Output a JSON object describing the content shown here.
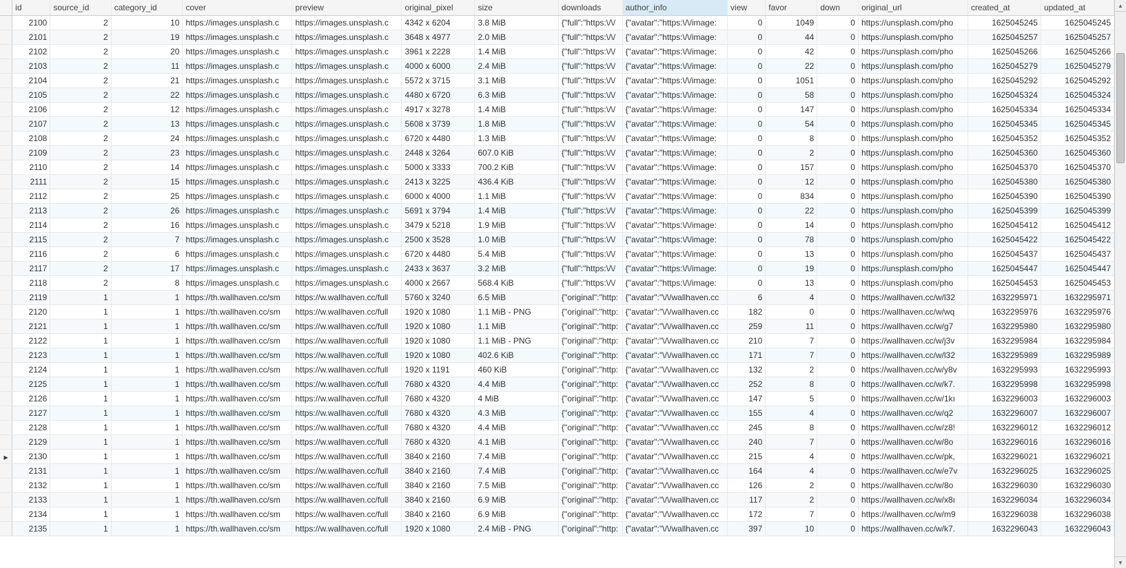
{
  "columns": [
    "id",
    "source_id",
    "category_id",
    "cover",
    "preview",
    "original_pixel",
    "size",
    "downloads",
    "author_info",
    "view",
    "favor",
    "down",
    "original_url",
    "created_at",
    "updated_at"
  ],
  "selected_column_index": 8,
  "current_row_id": 2130,
  "rows": [
    {
      "id": 2100,
      "source_id": 2,
      "category_id": 10,
      "cover": "https://images.unsplash.c",
      "preview": "https://images.unsplash.c",
      "original_pixel": "4342 x 6204",
      "size": "3.8 MiB",
      "downloads": "{\"full\":\"https:\\/\\/",
      "author_info": "{\"avatar\":\"https:\\/\\/image:",
      "view": 0,
      "favor": 1049,
      "down": 0,
      "original_url": "https://unsplash.com/pho",
      "created_at": 1625045245,
      "updated_at": 1625045245
    },
    {
      "id": 2101,
      "source_id": 2,
      "category_id": 19,
      "cover": "https://images.unsplash.c",
      "preview": "https://images.unsplash.c",
      "original_pixel": "3648 x 4977",
      "size": "2.0 MiB",
      "downloads": "{\"full\":\"https:\\/\\/",
      "author_info": "{\"avatar\":\"https:\\/\\/image:",
      "view": 0,
      "favor": 44,
      "down": 0,
      "original_url": "https://unsplash.com/pho",
      "created_at": 1625045257,
      "updated_at": 1625045257
    },
    {
      "id": 2102,
      "source_id": 2,
      "category_id": 20,
      "cover": "https://images.unsplash.c",
      "preview": "https://images.unsplash.c",
      "original_pixel": "3961 x 2228",
      "size": "1.4 MiB",
      "downloads": "{\"full\":\"https:\\/\\/",
      "author_info": "{\"avatar\":\"https:\\/\\/image:",
      "view": 0,
      "favor": 42,
      "down": 0,
      "original_url": "https://unsplash.com/pho",
      "created_at": 1625045266,
      "updated_at": 1625045266
    },
    {
      "id": 2103,
      "source_id": 2,
      "category_id": 11,
      "cover": "https://images.unsplash.c",
      "preview": "https://images.unsplash.c",
      "original_pixel": "4000 x 6000",
      "size": "2.4 MiB",
      "downloads": "{\"full\":\"https:\\/\\/",
      "author_info": "{\"avatar\":\"https:\\/\\/image:",
      "view": 0,
      "favor": 22,
      "down": 0,
      "original_url": "https://unsplash.com/pho",
      "created_at": 1625045279,
      "updated_at": 1625045279
    },
    {
      "id": 2104,
      "source_id": 2,
      "category_id": 21,
      "cover": "https://images.unsplash.c",
      "preview": "https://images.unsplash.c",
      "original_pixel": "5572 x 3715",
      "size": "3.1 MiB",
      "downloads": "{\"full\":\"https:\\/\\/",
      "author_info": "{\"avatar\":\"https:\\/\\/image:",
      "view": 0,
      "favor": 1051,
      "down": 0,
      "original_url": "https://unsplash.com/pho",
      "created_at": 1625045292,
      "updated_at": 1625045292
    },
    {
      "id": 2105,
      "source_id": 2,
      "category_id": 22,
      "cover": "https://images.unsplash.c",
      "preview": "https://images.unsplash.c",
      "original_pixel": "4480 x 6720",
      "size": "6.3 MiB",
      "downloads": "{\"full\":\"https:\\/\\/",
      "author_info": "{\"avatar\":\"https:\\/\\/image:",
      "view": 0,
      "favor": 58,
      "down": 0,
      "original_url": "https://unsplash.com/pho",
      "created_at": 1625045324,
      "updated_at": 1625045324
    },
    {
      "id": 2106,
      "source_id": 2,
      "category_id": 12,
      "cover": "https://images.unsplash.c",
      "preview": "https://images.unsplash.c",
      "original_pixel": "4917 x 3278",
      "size": "1.4 MiB",
      "downloads": "{\"full\":\"https:\\/\\/",
      "author_info": "{\"avatar\":\"https:\\/\\/image:",
      "view": 0,
      "favor": 147,
      "down": 0,
      "original_url": "https://unsplash.com/pho",
      "created_at": 1625045334,
      "updated_at": 1625045334
    },
    {
      "id": 2107,
      "source_id": 2,
      "category_id": 13,
      "cover": "https://images.unsplash.c",
      "preview": "https://images.unsplash.c",
      "original_pixel": "5608 x 3739",
      "size": "1.8 MiB",
      "downloads": "{\"full\":\"https:\\/\\/",
      "author_info": "{\"avatar\":\"https:\\/\\/image:",
      "view": 0,
      "favor": 54,
      "down": 0,
      "original_url": "https://unsplash.com/pho",
      "created_at": 1625045345,
      "updated_at": 1625045345
    },
    {
      "id": 2108,
      "source_id": 2,
      "category_id": 24,
      "cover": "https://images.unsplash.c",
      "preview": "https://images.unsplash.c",
      "original_pixel": "6720 x 4480",
      "size": "1.3 MiB",
      "downloads": "{\"full\":\"https:\\/\\/",
      "author_info": "{\"avatar\":\"https:\\/\\/image:",
      "view": 0,
      "favor": 8,
      "down": 0,
      "original_url": "https://unsplash.com/pho",
      "created_at": 1625045352,
      "updated_at": 1625045352
    },
    {
      "id": 2109,
      "source_id": 2,
      "category_id": 23,
      "cover": "https://images.unsplash.c",
      "preview": "https://images.unsplash.c",
      "original_pixel": "2448 x 3264",
      "size": "607.0 KiB",
      "downloads": "{\"full\":\"https:\\/\\/",
      "author_info": "{\"avatar\":\"https:\\/\\/image:",
      "view": 0,
      "favor": 2,
      "down": 0,
      "original_url": "https://unsplash.com/pho",
      "created_at": 1625045360,
      "updated_at": 1625045360
    },
    {
      "id": 2110,
      "source_id": 2,
      "category_id": 14,
      "cover": "https://images.unsplash.c",
      "preview": "https://images.unsplash.c",
      "original_pixel": "5000 x 3333",
      "size": "700.2 KiB",
      "downloads": "{\"full\":\"https:\\/\\/",
      "author_info": "{\"avatar\":\"https:\\/\\/image:",
      "view": 0,
      "favor": 157,
      "down": 0,
      "original_url": "https://unsplash.com/pho",
      "created_at": 1625045370,
      "updated_at": 1625045370
    },
    {
      "id": 2111,
      "source_id": 2,
      "category_id": 15,
      "cover": "https://images.unsplash.c",
      "preview": "https://images.unsplash.c",
      "original_pixel": "2413 x 3225",
      "size": "436.4 KiB",
      "downloads": "{\"full\":\"https:\\/\\/",
      "author_info": "{\"avatar\":\"https:\\/\\/image:",
      "view": 0,
      "favor": 12,
      "down": 0,
      "original_url": "https://unsplash.com/pho",
      "created_at": 1625045380,
      "updated_at": 1625045380
    },
    {
      "id": 2112,
      "source_id": 2,
      "category_id": 25,
      "cover": "https://images.unsplash.c",
      "preview": "https://images.unsplash.c",
      "original_pixel": "6000 x 4000",
      "size": "1.1 MiB",
      "downloads": "{\"full\":\"https:\\/\\/",
      "author_info": "{\"avatar\":\"https:\\/\\/image:",
      "view": 0,
      "favor": 834,
      "down": 0,
      "original_url": "https://unsplash.com/pho",
      "created_at": 1625045390,
      "updated_at": 1625045390
    },
    {
      "id": 2113,
      "source_id": 2,
      "category_id": 26,
      "cover": "https://images.unsplash.c",
      "preview": "https://images.unsplash.c",
      "original_pixel": "5691 x 3794",
      "size": "1.4 MiB",
      "downloads": "{\"full\":\"https:\\/\\/",
      "author_info": "{\"avatar\":\"https:\\/\\/image:",
      "view": 0,
      "favor": 22,
      "down": 0,
      "original_url": "https://unsplash.com/pho",
      "created_at": 1625045399,
      "updated_at": 1625045399
    },
    {
      "id": 2114,
      "source_id": 2,
      "category_id": 16,
      "cover": "https://images.unsplash.c",
      "preview": "https://images.unsplash.c",
      "original_pixel": "3479 x 5218",
      "size": "1.9 MiB",
      "downloads": "{\"full\":\"https:\\/\\/",
      "author_info": "{\"avatar\":\"https:\\/\\/image:",
      "view": 0,
      "favor": 14,
      "down": 0,
      "original_url": "https://unsplash.com/pho",
      "created_at": 1625045412,
      "updated_at": 1625045412
    },
    {
      "id": 2115,
      "source_id": 2,
      "category_id": 7,
      "cover": "https://images.unsplash.c",
      "preview": "https://images.unsplash.c",
      "original_pixel": "2500 x 3528",
      "size": "1.0 MiB",
      "downloads": "{\"full\":\"https:\\/\\/",
      "author_info": "{\"avatar\":\"https:\\/\\/image:",
      "view": 0,
      "favor": 78,
      "down": 0,
      "original_url": "https://unsplash.com/pho",
      "created_at": 1625045422,
      "updated_at": 1625045422
    },
    {
      "id": 2116,
      "source_id": 2,
      "category_id": 6,
      "cover": "https://images.unsplash.c",
      "preview": "https://images.unsplash.c",
      "original_pixel": "6720 x 4480",
      "size": "5.4 MiB",
      "downloads": "{\"full\":\"https:\\/\\/",
      "author_info": "{\"avatar\":\"https:\\/\\/image:",
      "view": 0,
      "favor": 13,
      "down": 0,
      "original_url": "https://unsplash.com/pho",
      "created_at": 1625045437,
      "updated_at": 1625045437
    },
    {
      "id": 2117,
      "source_id": 2,
      "category_id": 17,
      "cover": "https://images.unsplash.c",
      "preview": "https://images.unsplash.c",
      "original_pixel": "2433 x 3637",
      "size": "3.2 MiB",
      "downloads": "{\"full\":\"https:\\/\\/",
      "author_info": "{\"avatar\":\"https:\\/\\/image:",
      "view": 0,
      "favor": 19,
      "down": 0,
      "original_url": "https://unsplash.com/pho",
      "created_at": 1625045447,
      "updated_at": 1625045447
    },
    {
      "id": 2118,
      "source_id": 2,
      "category_id": 8,
      "cover": "https://images.unsplash.c",
      "preview": "https://images.unsplash.c",
      "original_pixel": "4000 x 2667",
      "size": "568.4 KiB",
      "downloads": "{\"full\":\"https:\\/\\/",
      "author_info": "{\"avatar\":\"https:\\/\\/image:",
      "view": 0,
      "favor": 13,
      "down": 0,
      "original_url": "https://unsplash.com/pho",
      "created_at": 1625045453,
      "updated_at": 1625045453
    },
    {
      "id": 2119,
      "source_id": 1,
      "category_id": 1,
      "cover": "https://th.wallhaven.cc/sm",
      "preview": "https://w.wallhaven.cc/full",
      "original_pixel": "5760 x 3240",
      "size": "6.5 MiB",
      "downloads": "{\"original\":\"http:",
      "author_info": "{\"avatar\":\"\\/\\/wallhaven.cc",
      "view": 6,
      "favor": 4,
      "down": 0,
      "original_url": "https://wallhaven.cc/w/l32",
      "created_at": 1632295971,
      "updated_at": 1632295971
    },
    {
      "id": 2120,
      "source_id": 1,
      "category_id": 1,
      "cover": "https://th.wallhaven.cc/sm",
      "preview": "https://w.wallhaven.cc/full",
      "original_pixel": "1920 x 1080",
      "size": "1.1 MiB - PNG",
      "downloads": "{\"original\":\"http:",
      "author_info": "{\"avatar\":\"\\/\\/wallhaven.cc",
      "view": 182,
      "favor": 0,
      "down": 0,
      "original_url": "https://wallhaven.cc/w/wq",
      "created_at": 1632295976,
      "updated_at": 1632295976
    },
    {
      "id": 2121,
      "source_id": 1,
      "category_id": 1,
      "cover": "https://th.wallhaven.cc/sm",
      "preview": "https://w.wallhaven.cc/full",
      "original_pixel": "1920 x 1080",
      "size": "1.1 MiB",
      "downloads": "{\"original\":\"http:",
      "author_info": "{\"avatar\":\"\\/\\/wallhaven.cc",
      "view": 259,
      "favor": 11,
      "down": 0,
      "original_url": "https://wallhaven.cc/w/g7",
      "created_at": 1632295980,
      "updated_at": 1632295980
    },
    {
      "id": 2122,
      "source_id": 1,
      "category_id": 1,
      "cover": "https://th.wallhaven.cc/sm",
      "preview": "https://w.wallhaven.cc/full",
      "original_pixel": "1920 x 1080",
      "size": "1.1 MiB - PNG",
      "downloads": "{\"original\":\"http:",
      "author_info": "{\"avatar\":\"\\/\\/wallhaven.cc",
      "view": 210,
      "favor": 7,
      "down": 0,
      "original_url": "https://wallhaven.cc/w/j3v",
      "created_at": 1632295984,
      "updated_at": 1632295984
    },
    {
      "id": 2123,
      "source_id": 1,
      "category_id": 1,
      "cover": "https://th.wallhaven.cc/sm",
      "preview": "https://w.wallhaven.cc/full",
      "original_pixel": "1920 x 1080",
      "size": "402.6 KiB",
      "downloads": "{\"original\":\"http:",
      "author_info": "{\"avatar\":\"\\/\\/wallhaven.cc",
      "view": 171,
      "favor": 7,
      "down": 0,
      "original_url": "https://wallhaven.cc/w/l32",
      "created_at": 1632295989,
      "updated_at": 1632295989
    },
    {
      "id": 2124,
      "source_id": 1,
      "category_id": 1,
      "cover": "https://th.wallhaven.cc/sm",
      "preview": "https://w.wallhaven.cc/full",
      "original_pixel": "1920 x 1191",
      "size": "460 KiB",
      "downloads": "{\"original\":\"http:",
      "author_info": "{\"avatar\":\"\\/\\/wallhaven.cc",
      "view": 132,
      "favor": 2,
      "down": 0,
      "original_url": "https://wallhaven.cc/w/y8v",
      "created_at": 1632295993,
      "updated_at": 1632295993
    },
    {
      "id": 2125,
      "source_id": 1,
      "category_id": 1,
      "cover": "https://th.wallhaven.cc/sm",
      "preview": "https://w.wallhaven.cc/full",
      "original_pixel": "7680 x 4320",
      "size": "4.4 MiB",
      "downloads": "{\"original\":\"http:",
      "author_info": "{\"avatar\":\"\\/\\/wallhaven.cc",
      "view": 252,
      "favor": 8,
      "down": 0,
      "original_url": "https://wallhaven.cc/w/k7.",
      "created_at": 1632295998,
      "updated_at": 1632295998
    },
    {
      "id": 2126,
      "source_id": 1,
      "category_id": 1,
      "cover": "https://th.wallhaven.cc/sm",
      "preview": "https://w.wallhaven.cc/full",
      "original_pixel": "7680 x 4320",
      "size": "4 MiB",
      "downloads": "{\"original\":\"http:",
      "author_info": "{\"avatar\":\"\\/\\/wallhaven.cc",
      "view": 147,
      "favor": 5,
      "down": 0,
      "original_url": "https://wallhaven.cc/w/1kı",
      "created_at": 1632296003,
      "updated_at": 1632296003
    },
    {
      "id": 2127,
      "source_id": 1,
      "category_id": 1,
      "cover": "https://th.wallhaven.cc/sm",
      "preview": "https://w.wallhaven.cc/full",
      "original_pixel": "7680 x 4320",
      "size": "4.3 MiB",
      "downloads": "{\"original\":\"http:",
      "author_info": "{\"avatar\":\"\\/\\/wallhaven.cc",
      "view": 155,
      "favor": 4,
      "down": 0,
      "original_url": "https://wallhaven.cc/w/q2",
      "created_at": 1632296007,
      "updated_at": 1632296007
    },
    {
      "id": 2128,
      "source_id": 1,
      "category_id": 1,
      "cover": "https://th.wallhaven.cc/sm",
      "preview": "https://w.wallhaven.cc/full",
      "original_pixel": "7680 x 4320",
      "size": "4.4 MiB",
      "downloads": "{\"original\":\"http:",
      "author_info": "{\"avatar\":\"\\/\\/wallhaven.cc",
      "view": 245,
      "favor": 8,
      "down": 0,
      "original_url": "https://wallhaven.cc/w/z8!",
      "created_at": 1632296012,
      "updated_at": 1632296012
    },
    {
      "id": 2129,
      "source_id": 1,
      "category_id": 1,
      "cover": "https://th.wallhaven.cc/sm",
      "preview": "https://w.wallhaven.cc/full",
      "original_pixel": "7680 x 4320",
      "size": "4.1 MiB",
      "downloads": "{\"original\":\"http:",
      "author_info": "{\"avatar\":\"\\/\\/wallhaven.cc",
      "view": 240,
      "favor": 7,
      "down": 0,
      "original_url": "https://wallhaven.cc/w/8o",
      "created_at": 1632296016,
      "updated_at": 1632296016
    },
    {
      "id": 2130,
      "source_id": 1,
      "category_id": 1,
      "cover": "https://th.wallhaven.cc/sm",
      "preview": "https://w.wallhaven.cc/full",
      "original_pixel": "3840 x 2160",
      "size": "7.4 MiB",
      "downloads": "{\"original\":\"http:",
      "author_info": "{\"avatar\":\"\\/\\/wallhaven.cc",
      "view": 215,
      "favor": 4,
      "down": 0,
      "original_url": "https://wallhaven.cc/w/pk,",
      "created_at": 1632296021,
      "updated_at": 1632296021
    },
    {
      "id": 2131,
      "source_id": 1,
      "category_id": 1,
      "cover": "https://th.wallhaven.cc/sm",
      "preview": "https://w.wallhaven.cc/full",
      "original_pixel": "3840 x 2160",
      "size": "7.4 MiB",
      "downloads": "{\"original\":\"http:",
      "author_info": "{\"avatar\":\"\\/\\/wallhaven.cc",
      "view": 164,
      "favor": 4,
      "down": 0,
      "original_url": "https://wallhaven.cc/w/e7v",
      "created_at": 1632296025,
      "updated_at": 1632296025
    },
    {
      "id": 2132,
      "source_id": 1,
      "category_id": 1,
      "cover": "https://th.wallhaven.cc/sm",
      "preview": "https://w.wallhaven.cc/full",
      "original_pixel": "3840 x 2160",
      "size": "7.5 MiB",
      "downloads": "{\"original\":\"http:",
      "author_info": "{\"avatar\":\"\\/\\/wallhaven.cc",
      "view": 126,
      "favor": 2,
      "down": 0,
      "original_url": "https://wallhaven.cc/w/8o",
      "created_at": 1632296030,
      "updated_at": 1632296030
    },
    {
      "id": 2133,
      "source_id": 1,
      "category_id": 1,
      "cover": "https://th.wallhaven.cc/sm",
      "preview": "https://w.wallhaven.cc/full",
      "original_pixel": "3840 x 2160",
      "size": "6.9 MiB",
      "downloads": "{\"original\":\"http:",
      "author_info": "{\"avatar\":\"\\/\\/wallhaven.cc",
      "view": 117,
      "favor": 2,
      "down": 0,
      "original_url": "https://wallhaven.cc/w/x8ı",
      "created_at": 1632296034,
      "updated_at": 1632296034
    },
    {
      "id": 2134,
      "source_id": 1,
      "category_id": 1,
      "cover": "https://th.wallhaven.cc/sm",
      "preview": "https://w.wallhaven.cc/full",
      "original_pixel": "3840 x 2160",
      "size": "6.9 MiB",
      "downloads": "{\"original\":\"http:",
      "author_info": "{\"avatar\":\"\\/\\/wallhaven.cc",
      "view": 172,
      "favor": 7,
      "down": 0,
      "original_url": "https://wallhaven.cc/w/m9",
      "created_at": 1632296038,
      "updated_at": 1632296038
    },
    {
      "id": 2135,
      "source_id": 1,
      "category_id": 1,
      "cover": "https://th.wallhaven.cc/sm",
      "preview": "https://w.wallhaven.cc/full",
      "original_pixel": "1920 x 1080",
      "size": "2.4 MiB - PNG",
      "downloads": "{\"original\":\"http:",
      "author_info": "{\"avatar\":\"\\/\\/wallhaven.cc",
      "view": 397,
      "favor": 10,
      "down": 0,
      "original_url": "https://wallhaven.cc/w/k7.",
      "created_at": 1632296043,
      "updated_at": 1632296043
    }
  ]
}
